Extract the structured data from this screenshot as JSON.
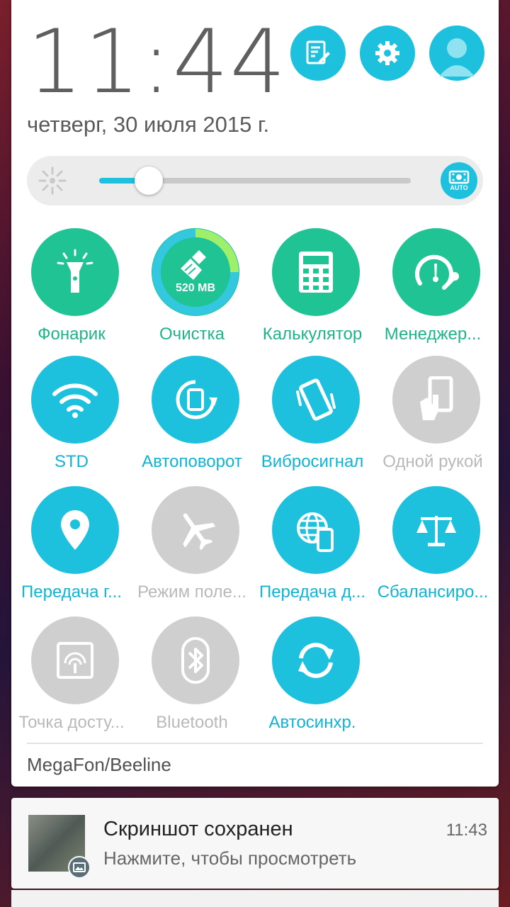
{
  "header": {
    "time": "11:44",
    "date": "четверг, 30 июля 2015 г.",
    "icons": [
      "edit-notes-icon",
      "settings-gear-icon",
      "user-avatar-icon"
    ]
  },
  "brightness": {
    "level": 0.16,
    "auto_label": "AUTO"
  },
  "tiles": [
    {
      "label": "Фонарик",
      "icon": "flashlight-icon",
      "state": "on",
      "color": "#1fc394"
    },
    {
      "label": "Очистка",
      "icon": "cleanup-broom-icon",
      "state": "on",
      "color": "#1fc394",
      "badge": "520 MB"
    },
    {
      "label": "Калькулятор",
      "icon": "calculator-icon",
      "state": "on",
      "color": "#1fc394"
    },
    {
      "label": "Менеджер...",
      "icon": "power-manager-icon",
      "state": "on",
      "color": "#1fc394"
    },
    {
      "label": "STD",
      "icon": "wifi-icon",
      "state": "on",
      "color": "#1ec1dd"
    },
    {
      "label": "Автоповорот",
      "icon": "auto-rotate-icon",
      "state": "on",
      "color": "#1ec1dd"
    },
    {
      "label": "Вибросигнал",
      "icon": "vibrate-icon",
      "state": "on",
      "color": "#1ec1dd"
    },
    {
      "label": "Одной рукой",
      "icon": "one-hand-icon",
      "state": "off",
      "color": "#cfcfcf"
    },
    {
      "label": "Передача г...",
      "icon": "location-icon",
      "state": "on",
      "color": "#1ec1dd"
    },
    {
      "label": "Режим поле...",
      "icon": "airplane-icon",
      "state": "off",
      "color": "#cfcfcf"
    },
    {
      "label": "Передача д...",
      "icon": "mobile-data-icon",
      "state": "on",
      "color": "#1ec1dd"
    },
    {
      "label": "Сбалансиро...",
      "icon": "balance-icon",
      "state": "on",
      "color": "#1ec1dd"
    },
    {
      "label": "Точка досту...",
      "icon": "hotspot-icon",
      "state": "off",
      "color": "#cfcfcf"
    },
    {
      "label": "Bluetooth",
      "icon": "bluetooth-icon",
      "state": "off",
      "color": "#cfcfcf"
    },
    {
      "label": "Автосинхр.",
      "icon": "sync-icon",
      "state": "on",
      "color": "#1ec1dd"
    }
  ],
  "operator": "MegaFon/Beeline",
  "notification": {
    "title": "Скриншот сохранен",
    "text": "Нажмите, чтобы просмотреть",
    "time": "11:43"
  },
  "colors": {
    "accent_cyan": "#1ec1dd",
    "accent_green": "#1fc394",
    "inactive_gray": "#cfcfcf"
  }
}
